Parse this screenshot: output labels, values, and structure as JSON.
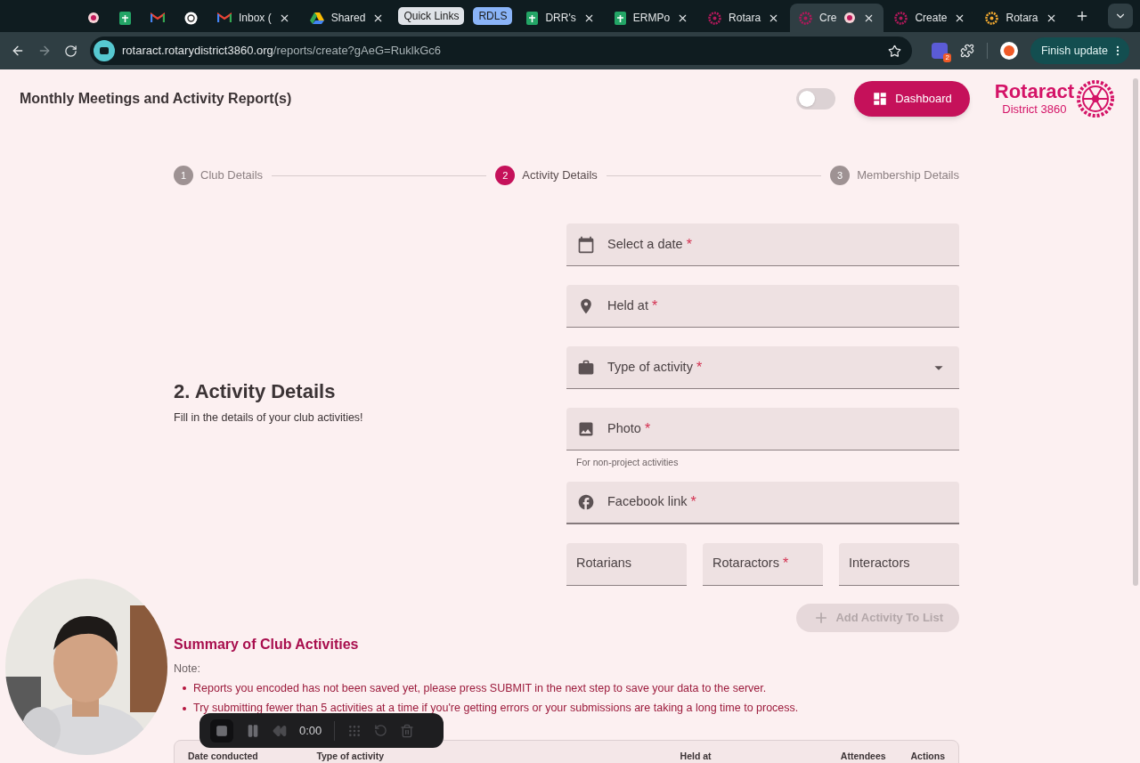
{
  "browser": {
    "tabs": [
      {
        "kind": "tab",
        "selected": false,
        "closable": false
      },
      {
        "kind": "tab",
        "selected": false,
        "closable": false
      },
      {
        "kind": "tab",
        "selected": false,
        "closable": false
      },
      {
        "kind": "tab",
        "selected": false,
        "closable": false
      },
      {
        "kind": "tab",
        "title": "Inbox (",
        "selected": false,
        "closable": true
      },
      {
        "kind": "tab",
        "title": "Shared",
        "selected": false,
        "closable": true
      },
      {
        "kind": "group",
        "title": "Quick Links",
        "color": "#dfe3e8"
      },
      {
        "kind": "group",
        "title": "RDLS",
        "color": "#8ab4f8"
      },
      {
        "kind": "tab",
        "title": "DRR's",
        "selected": false,
        "closable": true
      },
      {
        "kind": "tab",
        "title": "ERMPo",
        "selected": false,
        "closable": true
      },
      {
        "kind": "tab",
        "title": "Rotara",
        "selected": false,
        "closable": true
      },
      {
        "kind": "tab",
        "title": "Cre",
        "selected": true,
        "closable": true
      },
      {
        "kind": "tab",
        "title": "Create",
        "selected": false,
        "closable": true
      },
      {
        "kind": "tab",
        "title": "Rotara",
        "selected": false,
        "closable": true
      }
    ],
    "url_host": "rotaract.rotarydistrict3860.org",
    "url_path": "/reports/create?gAeG=RuklkGc6",
    "extension_badge": "2",
    "update_button": "Finish update"
  },
  "header": {
    "title": "Monthly Meetings and Activity Report(s)",
    "toggle": {
      "on": false
    },
    "dashboard_button": "Dashboard",
    "logo": {
      "name": "Rotaract",
      "district": "District 3860"
    }
  },
  "stepper": [
    {
      "number": "1",
      "label": "Club Details",
      "selected": false
    },
    {
      "number": "2",
      "label": "Activity Details",
      "selected": true
    },
    {
      "number": "3",
      "label": "Membership Details",
      "selected": false
    }
  ],
  "section": {
    "title": "2. Activity Details",
    "subtitle": "Fill in the details of your club activities!"
  },
  "fields": [
    {
      "label": "Select a date",
      "required_mark": "*",
      "dropdown": false,
      "focused": false
    },
    {
      "label": "Held at",
      "required_mark": "*",
      "dropdown": false,
      "focused": false
    },
    {
      "label": "Type of activity",
      "required_mark": "*",
      "dropdown": true,
      "focused": false
    },
    {
      "label": "Photo",
      "required_mark": "*",
      "dropdown": false,
      "focused": false,
      "helper": "For non-project activities"
    },
    {
      "label": "Facebook link",
      "required_mark": "*",
      "dropdown": false,
      "focused": true
    }
  ],
  "attendee_fields": [
    {
      "label": "Rotarians"
    },
    {
      "label": "Rotaractors",
      "required_mark": "*"
    },
    {
      "label": "Interactors"
    }
  ],
  "add_button": {
    "label": "Add Activity To List",
    "disabled": true
  },
  "summary": {
    "title": "Summary of Club Activities",
    "note_label": "Note:",
    "notes": [
      "Reports you encoded has not been saved yet, please press SUBMIT in the next step to save your data to the server.",
      "Try submitting fewer than 5 activities at a time if you're getting errors or your submissions are taking a long time to process."
    ]
  },
  "table": {
    "columns": [
      "Date conducted",
      "Type of activity",
      "Held at",
      "Attendees",
      "Actions"
    ]
  },
  "recorder": {
    "time": "0:00"
  }
}
